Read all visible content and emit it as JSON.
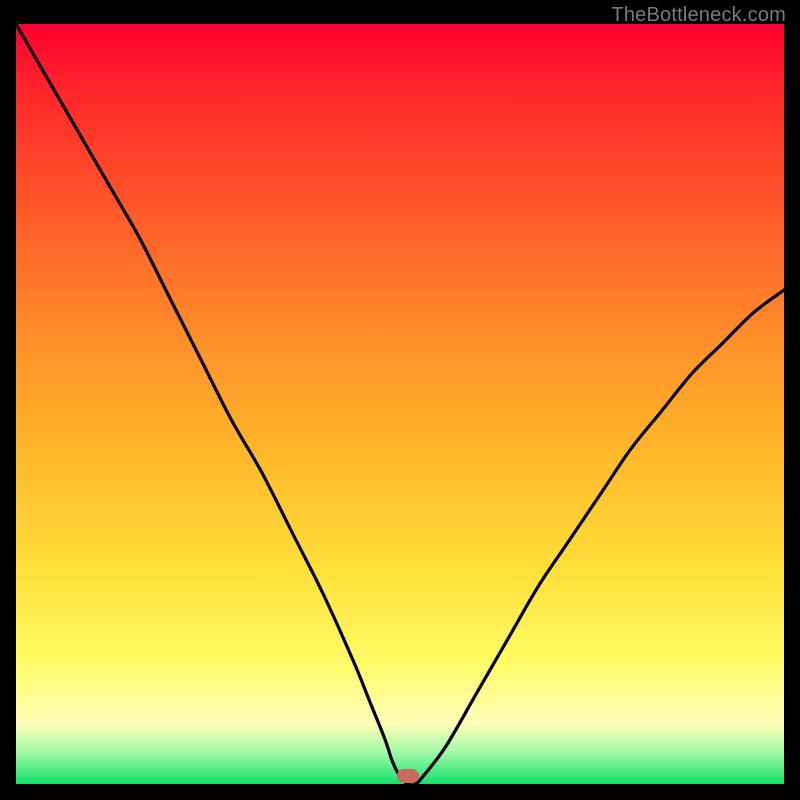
{
  "watermark": "TheBottleneck.com",
  "colors": {
    "background": "#000000",
    "curve": "#000000",
    "marker": "#c86a5e",
    "gradient_top": "#ff0030",
    "gradient_bottom": "#14e06a"
  },
  "chart_data": {
    "type": "line",
    "title": "",
    "xlabel": "",
    "ylabel": "",
    "xlim": [
      0,
      100
    ],
    "ylim": [
      0,
      100
    ],
    "grid": false,
    "annotations": [
      {
        "kind": "marker",
        "x": 51,
        "y": 1
      }
    ],
    "series": [
      {
        "name": "bottleneck-curve",
        "x": [
          0,
          4,
          8,
          12,
          16,
          20,
          24,
          28,
          32,
          36,
          40,
          44,
          46,
          48,
          49,
          50,
          51,
          52,
          53,
          56,
          60,
          64,
          68,
          72,
          76,
          80,
          84,
          88,
          92,
          96,
          100
        ],
        "values": [
          100,
          93,
          86,
          79,
          72,
          64,
          56,
          48,
          41,
          33,
          25,
          16,
          11,
          6,
          3,
          1,
          0,
          0,
          1,
          5,
          12,
          19,
          26,
          32,
          38,
          44,
          49,
          54,
          58,
          62,
          65
        ]
      }
    ]
  }
}
